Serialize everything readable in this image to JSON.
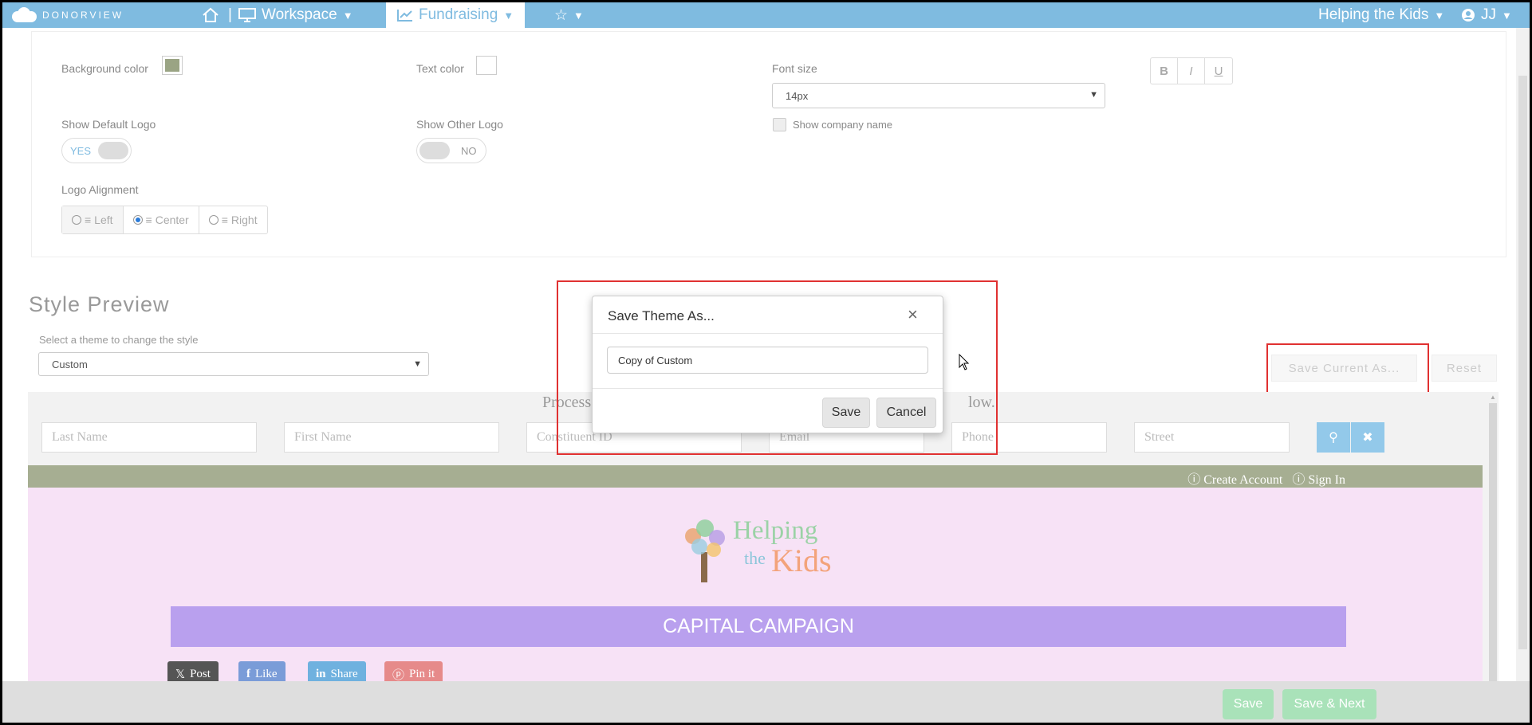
{
  "nav": {
    "brand": "DONORVIEW",
    "workspace": "Workspace",
    "fundraising": "Fundraising",
    "org": "Helping the Kids",
    "user": "JJ",
    "separator": "|"
  },
  "settings": {
    "background_color_label": "Background color",
    "background_color": "#9aa484",
    "text_color_label": "Text color",
    "text_color": "#ffffff",
    "font_size_label": "Font size",
    "font_size_value": "14px",
    "format_buttons": [
      "B",
      "I",
      "U"
    ],
    "show_default_logo_label": "Show Default Logo",
    "show_default_logo_value": "YES",
    "show_other_logo_label": "Show Other Logo",
    "show_other_logo_value": "NO",
    "show_company_name_label": "Show company name",
    "logo_alignment_label": "Logo Alignment",
    "alignment_options": [
      "Left",
      "Center",
      "Right"
    ],
    "alignment_selected": "Center"
  },
  "style_preview": {
    "title": "Style Preview",
    "theme_select_label": "Select a theme to change the style",
    "theme_value": "Custom",
    "save_current_as": "Save Current As...",
    "reset": "Reset"
  },
  "preview": {
    "process_left": "Process",
    "process_right": "low.",
    "fields": [
      "Last Name",
      "First Name",
      "Constituent ID",
      "Email",
      "Phone",
      "Street"
    ],
    "create_account": "Create Account",
    "sign_in": "Sign In",
    "logo_line1": "Helping",
    "logo_line2": "the",
    "logo_line3": "Kids",
    "campaign": "CAPITAL CAMPAIGN",
    "social": [
      "Post",
      "Like",
      "Share",
      "Pin it"
    ],
    "bar_color": "#a6ae92",
    "page_color": "#f7e2f6",
    "banner_color": "#b9a0ee"
  },
  "modal": {
    "title": "Save Theme As...",
    "input_value": "Copy of Custom",
    "save": "Save",
    "cancel": "Cancel"
  },
  "footer": {
    "save": "Save",
    "save_next": "Save & Next"
  }
}
